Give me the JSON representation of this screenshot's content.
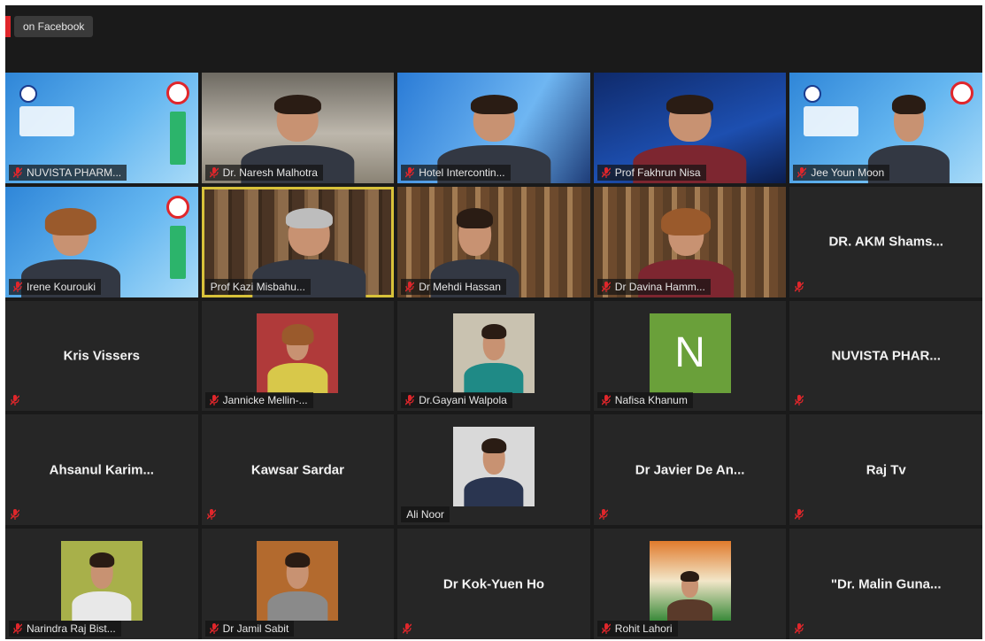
{
  "topbar": {
    "live_label": "on Facebook"
  },
  "participants": [
    {
      "name": "NUVISTA PHARM..."
    },
    {
      "name": "Dr. Naresh Malhotra"
    },
    {
      "name": "Hotel Intercontin..."
    },
    {
      "name": "Prof Fakhrun Nisa"
    },
    {
      "name": "Jee Youn Moon"
    },
    {
      "name": "Irene Kourouki"
    },
    {
      "name": "Prof Kazi Misbahu..."
    },
    {
      "name": "Dr Mehdi Hassan"
    },
    {
      "name": "Dr Davina Hamm..."
    },
    {
      "name": "DR. AKM Shams..."
    },
    {
      "name": "Kris Vissers"
    },
    {
      "name": "Jannicke Mellin-..."
    },
    {
      "name": "Dr.Gayani Walpola"
    },
    {
      "name": "Nafisa Khanum",
      "initial": "N"
    },
    {
      "name": "NUVISTA PHAR..."
    },
    {
      "name": "Ahsanul Karim..."
    },
    {
      "name": "Kawsar Sardar"
    },
    {
      "name": "Ali Noor"
    },
    {
      "name": "Dr Javier De An..."
    },
    {
      "name": "Raj Tv"
    },
    {
      "name": "Narindra Raj Bist..."
    },
    {
      "name": "Dr Jamil Sabit"
    },
    {
      "name": "Dr Kok-Yuen Ho"
    },
    {
      "name": "Rohit Lahori"
    },
    {
      "name": "\"Dr. Malin Guna..."
    }
  ],
  "colors": {
    "background": "#1a1a1a",
    "tile": "#262626",
    "active_speaker_border": "#d8c23a",
    "mic_muted": "#e0262b",
    "avatar_initial_bg": "#6aa03a"
  },
  "icons": {
    "mic_muted": "mic-off-icon"
  }
}
